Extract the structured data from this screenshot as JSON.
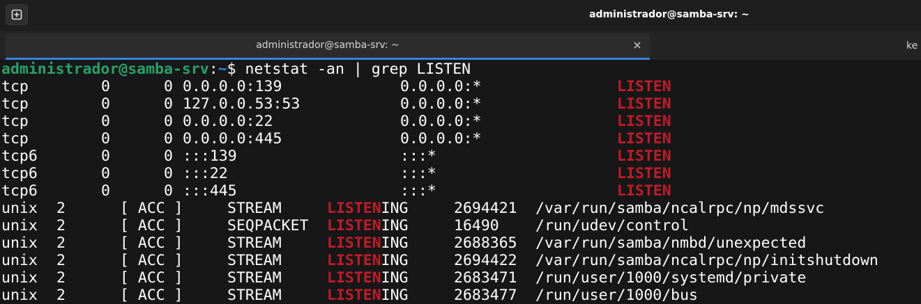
{
  "window": {
    "title": "administrador@samba-srv: ~"
  },
  "tabs": [
    {
      "label": "administrador@samba-srv: ~",
      "active": true
    },
    {
      "label": "ke",
      "active": false
    }
  ],
  "terminal": {
    "prompt": {
      "user_host": "administrador@samba-srv",
      "colon": ":",
      "path": "~",
      "symbol": "$ ",
      "command": "netstat -an | grep LISTEN"
    },
    "inet_rows": [
      {
        "proto": "tcp",
        "recvq": "0",
        "sendq": "0",
        "local": "0.0.0.0:139",
        "foreign": "0.0.0.0:*",
        "state": "LISTEN"
      },
      {
        "proto": "tcp",
        "recvq": "0",
        "sendq": "0",
        "local": "127.0.0.53:53",
        "foreign": "0.0.0.0:*",
        "state": "LISTEN"
      },
      {
        "proto": "tcp",
        "recvq": "0",
        "sendq": "0",
        "local": "0.0.0.0:22",
        "foreign": "0.0.0.0:*",
        "state": "LISTEN"
      },
      {
        "proto": "tcp",
        "recvq": "0",
        "sendq": "0",
        "local": "0.0.0.0:445",
        "foreign": "0.0.0.0:*",
        "state": "LISTEN"
      },
      {
        "proto": "tcp6",
        "recvq": "0",
        "sendq": "0",
        "local": ":::139",
        "foreign": ":::*",
        "state": "LISTEN"
      },
      {
        "proto": "tcp6",
        "recvq": "0",
        "sendq": "0",
        "local": ":::22",
        "foreign": ":::*",
        "state": "LISTEN"
      },
      {
        "proto": "tcp6",
        "recvq": "0",
        "sendq": "0",
        "local": ":::445",
        "foreign": ":::*",
        "state": "LISTEN"
      }
    ],
    "unix_rows": [
      {
        "proto": "unix",
        "refcnt": "2",
        "flags": "[ ACC ]",
        "type": "STREAM",
        "state_match": "LISTEN",
        "state_rest": "ING",
        "inode": "2694421",
        "path": "/var/run/samba/ncalrpc/np/mdssvc"
      },
      {
        "proto": "unix",
        "refcnt": "2",
        "flags": "[ ACC ]",
        "type": "SEQPACKET",
        "state_match": "LISTEN",
        "state_rest": "ING",
        "inode": "16490",
        "path": "/run/udev/control"
      },
      {
        "proto": "unix",
        "refcnt": "2",
        "flags": "[ ACC ]",
        "type": "STREAM",
        "state_match": "LISTEN",
        "state_rest": "ING",
        "inode": "2688365",
        "path": "/var/run/samba/nmbd/unexpected"
      },
      {
        "proto": "unix",
        "refcnt": "2",
        "flags": "[ ACC ]",
        "type": "STREAM",
        "state_match": "LISTEN",
        "state_rest": "ING",
        "inode": "2694422",
        "path": "/var/run/samba/ncalrpc/np/initshutdown"
      },
      {
        "proto": "unix",
        "refcnt": "2",
        "flags": "[ ACC ]",
        "type": "STREAM",
        "state_match": "LISTEN",
        "state_rest": "ING",
        "inode": "2683471",
        "path": "/run/user/1000/systemd/private"
      },
      {
        "proto": "unix",
        "refcnt": "2",
        "flags": "[ ACC ]",
        "type": "STREAM",
        "state_match": "LISTEN",
        "state_rest": "ING",
        "inode": "2683477",
        "path": "/run/user/1000/bus"
      }
    ]
  },
  "icons": {
    "new_tab": "new-tab-icon",
    "close": "close-icon"
  },
  "colors": {
    "prompt_user": "#26a269",
    "prompt_path": "#3584e4",
    "grep_match": "#c01c28",
    "tab_accent": "#3584e4",
    "background": "#171717"
  }
}
